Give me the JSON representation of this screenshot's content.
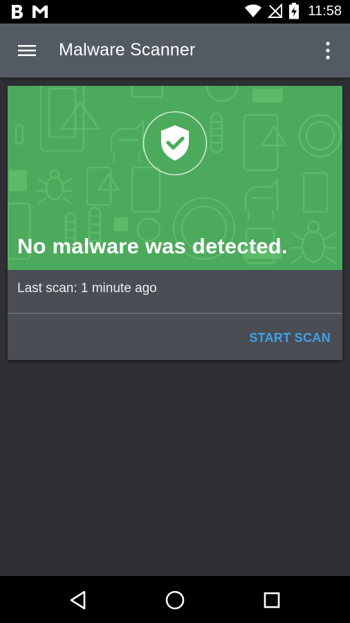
{
  "status_bar": {
    "time": "11:58",
    "left_icons": [
      "b-app-icon",
      "gmail-icon"
    ],
    "right_icons": [
      "wifi-icon",
      "no-signal-icon",
      "battery-charging-icon"
    ]
  },
  "app_bar": {
    "title": "Malware Scanner",
    "menu_icon": "hamburger-menu-icon",
    "overflow_icon": "more-vert-icon",
    "color": "#535a63"
  },
  "card": {
    "hero_color": "#4caa5c",
    "status_icon": "shield-check-icon",
    "headline": "No malware was detected.",
    "last_scan": "Last scan: 1 minute ago",
    "action_label": "START SCAN",
    "action_color": "#3ea1ea"
  },
  "nav_bar": {
    "buttons": [
      "back-icon",
      "home-icon",
      "recents-icon"
    ]
  }
}
